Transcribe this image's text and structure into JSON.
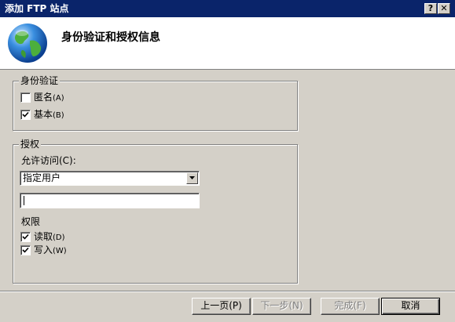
{
  "window": {
    "title": "添加 FTP 站点",
    "help_glyph": "?",
    "close_glyph": "✕"
  },
  "header": {
    "title": "身份验证和授权信息",
    "icon": "globe-icon"
  },
  "authentication": {
    "legend": "身份验证",
    "anonymous": {
      "label": "匿名",
      "accel": "(A)",
      "checked": false
    },
    "basic": {
      "label": "基本",
      "accel": "(B)",
      "checked": true
    }
  },
  "authorization": {
    "legend": "授权",
    "allow_access_label": "允许访问(C):",
    "allow_access_selected": "指定用户",
    "user_input_value": "",
    "permissions_label": "权限",
    "read": {
      "label": "读取",
      "accel": "(D)",
      "checked": true
    },
    "write": {
      "label": "写入",
      "accel": "(W)",
      "checked": true
    }
  },
  "buttons": {
    "back": "上一页(P)",
    "next": "下一步(N)",
    "finish": "完成(F)",
    "cancel": "取消"
  },
  "colors": {
    "title_bar": "#0a246a",
    "dialog_bg": "#d4d0c8"
  }
}
